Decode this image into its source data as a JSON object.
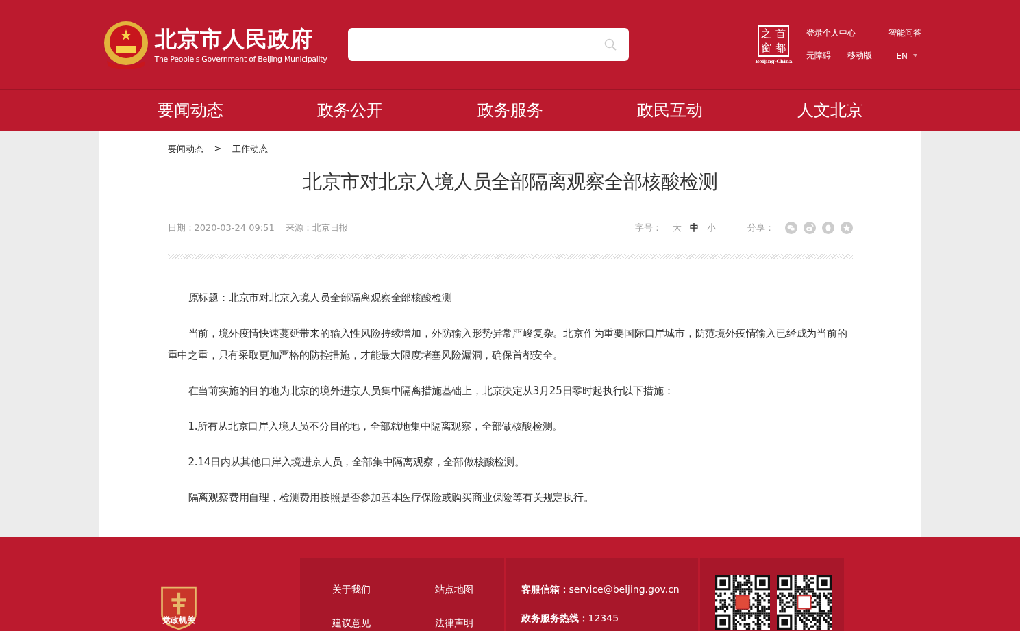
{
  "header": {
    "title": "北京市人民政府",
    "subtitle": "The People's Government of Beijing Municipality",
    "badge": {
      "chars": [
        "之",
        "首",
        "窗",
        "都"
      ],
      "caption": "Beijing-China"
    },
    "links": [
      {
        "label": "登录个人中心"
      },
      {
        "label": "智能问答"
      },
      {
        "label": "无障碍"
      },
      {
        "label": "移动版"
      },
      {
        "label": "EN",
        "kind": "dropdown"
      }
    ]
  },
  "nav": [
    {
      "label": "要闻动态"
    },
    {
      "label": "政务公开"
    },
    {
      "label": "政务服务"
    },
    {
      "label": "政民互动"
    },
    {
      "label": "人文北京"
    }
  ],
  "breadcrumb": [
    {
      "label": "要闻动态"
    },
    {
      "label": "工作动态"
    }
  ],
  "breadcrumb_separator": ">",
  "article": {
    "title": "北京市对北京入境人员全部隔离观察全部核酸检测",
    "date": "日期：2020-03-24 09:51",
    "source": "来源：北京日报",
    "font_size_label": "字号：",
    "font_sizes": [
      {
        "label": "大",
        "selected": false
      },
      {
        "label": "中",
        "selected": true
      },
      {
        "label": "小",
        "selected": false
      }
    ],
    "share_label": "分享：",
    "paragraphs": [
      "原标题：北京市对北京入境人员全部隔离观察全部核酸检测",
      "当前，境外疫情快速蔓延带来的输入性风险持续增加，外防输入形势异常严峻复杂。北京作为重要国际口岸城市，防范境外疫情输入已经成为当前的重中之重，只有采取更加严格的防控措施，才能最大限度堵塞风险漏洞，确保首都安全。",
      "在当前实施的目的地为北京的境外进京人员集中隔离措施基础上，北京决定从3月25日零时起执行以下措施：",
      "1.所有从北京口岸入境人员不分目的地，全部就地集中隔离观察，全部做核酸检测。",
      "2.14日内从其他口岸入境进京人员，全部集中隔离观察，全部做核酸检测。",
      "隔离观察费用自理，检测费用按照是否参加基本医疗保险或购买商业保险等有关规定执行。"
    ]
  },
  "footer": {
    "badge_caption": "党政机关",
    "links": [
      {
        "label": "关于我们"
      },
      {
        "label": "站点地图"
      },
      {
        "label": "建议意见"
      },
      {
        "label": "法律声明"
      }
    ],
    "contacts": [
      {
        "label": "客服信箱：",
        "value": "service@beijing.gov.cn"
      },
      {
        "label": "政务服务热线：",
        "value": "12345"
      }
    ]
  }
}
